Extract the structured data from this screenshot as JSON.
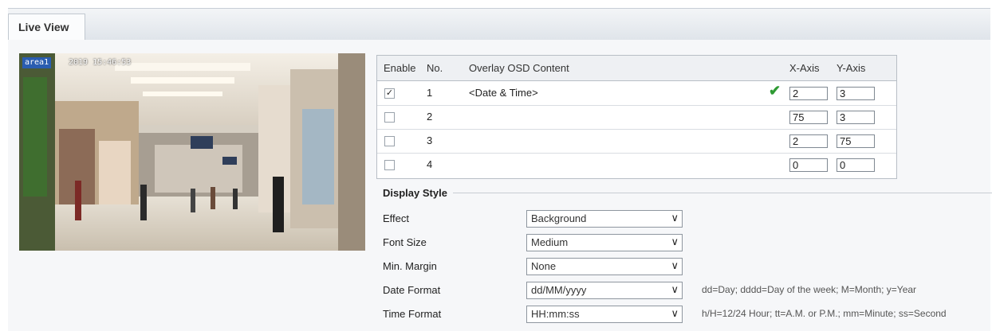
{
  "tabs": [
    {
      "label": "Live View"
    }
  ],
  "video": {
    "osd_label": "area1",
    "osd_time": "2019 15:46:53"
  },
  "osd_table": {
    "headers": {
      "enable": "Enable",
      "no": "No.",
      "content": "Overlay OSD Content",
      "x": "X-Axis",
      "y": "Y-Axis"
    },
    "rows": [
      {
        "checked": true,
        "no": "1",
        "content": "<Date & Time>",
        "x": "2",
        "y": "3"
      },
      {
        "checked": false,
        "no": "2",
        "content": "",
        "x": "75",
        "y": "3"
      },
      {
        "checked": false,
        "no": "3",
        "content": "",
        "x": "2",
        "y": "75"
      },
      {
        "checked": false,
        "no": "4",
        "content": "",
        "x": "0",
        "y": "0"
      }
    ]
  },
  "display_style": {
    "title": "Display Style",
    "fields": [
      {
        "label": "Effect",
        "value": "Background",
        "hint": ""
      },
      {
        "label": "Font Size",
        "value": "Medium",
        "hint": ""
      },
      {
        "label": "Min. Margin",
        "value": "None",
        "hint": ""
      },
      {
        "label": "Date Format",
        "value": "dd/MM/yyyy",
        "hint": "dd=Day; dddd=Day of the week; M=Month; y=Year"
      },
      {
        "label": "Time Format",
        "value": "HH:mm:ss",
        "hint": "h/H=12/24 Hour; tt=A.M. or P.M.; mm=Minute; ss=Second"
      }
    ]
  },
  "icons": {
    "check": "check-icon",
    "chevron": "chevron-down-icon"
  },
  "colors": {
    "accent": "#2e9a33",
    "osd_tag_bg": "#2a5db0"
  }
}
